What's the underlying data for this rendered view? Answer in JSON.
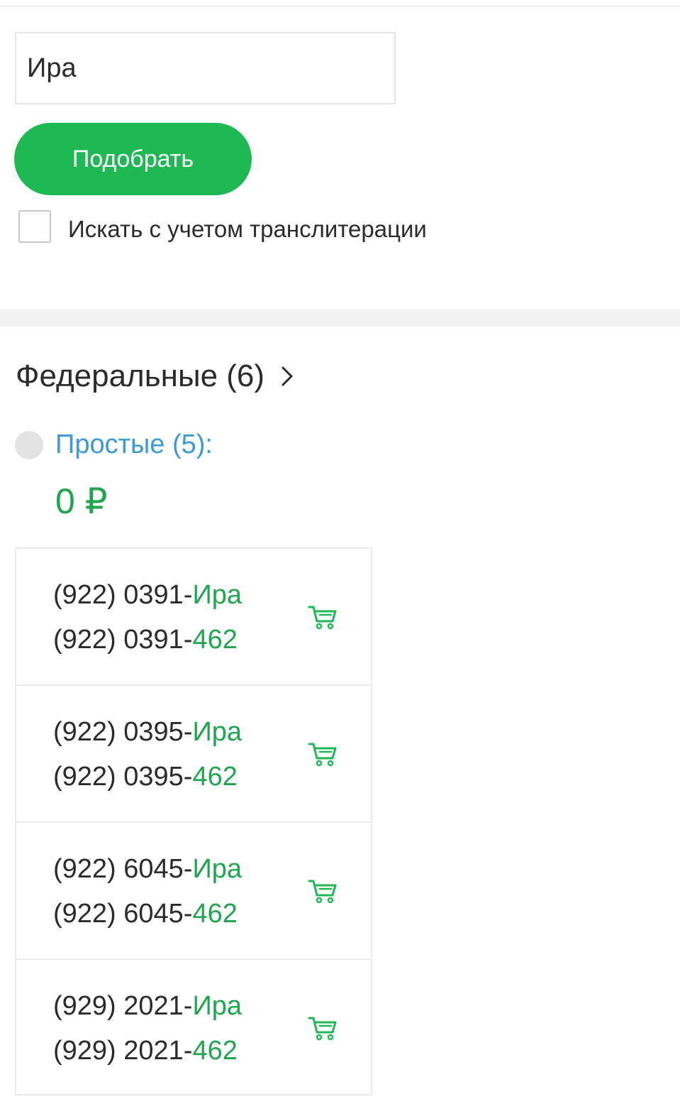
{
  "search": {
    "value": "Ира"
  },
  "pick_button": {
    "label": "Подобрать"
  },
  "transliteration": {
    "label": "Искать с учетом транслитерации",
    "checked": false
  },
  "section": {
    "title": "Федеральные (6)"
  },
  "category": {
    "label": "Простые (5):",
    "price": "0 ₽"
  },
  "numbers": [
    {
      "prefix1": "(922) 0391-",
      "suffix1": "Ира",
      "prefix2": "(922) 0391-",
      "suffix2": "462",
      "icon": "cart-icon"
    },
    {
      "prefix1": "(922) 0395-",
      "suffix1": "Ира",
      "prefix2": "(922) 0395-",
      "suffix2": "462",
      "icon": "cart-icon"
    },
    {
      "prefix1": "(922) 6045-",
      "suffix1": "Ира",
      "prefix2": "(922) 6045-",
      "suffix2": "462",
      "icon": "cart-icon"
    },
    {
      "prefix1": "(929) 2021-",
      "suffix1": "Ира",
      "prefix2": "(929) 2021-",
      "suffix2": "462",
      "icon": "cart-icon"
    }
  ],
  "colors": {
    "accent_green": "#1fb954",
    "highlight_green": "#1fa64e",
    "link_blue": "#3a9bd6"
  }
}
